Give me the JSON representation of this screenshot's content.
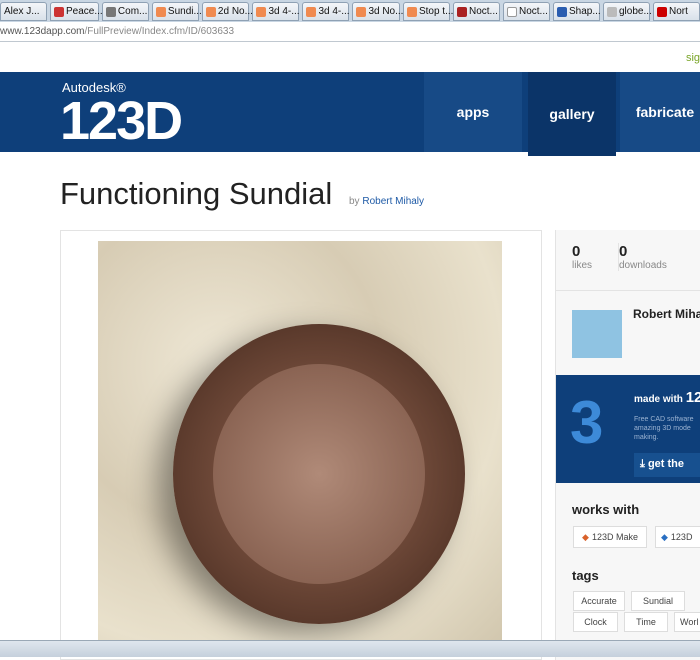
{
  "browser": {
    "tabs": [
      "Alex J...",
      "Peace...",
      "Com...",
      "Sundi...",
      "2d No...",
      "3d 4-...",
      "3d 4-...",
      "3d No...",
      "Stop t...",
      "Noct...",
      "Noct...",
      "Shap...",
      "globe...",
      "Nort"
    ],
    "url_domain": "www.123dapp.com",
    "url_path": "/FullPreview/Index.cfm/ID/603633"
  },
  "header": {
    "signin": "sig",
    "logo_small": "Autodesk®",
    "logo_big": "123D",
    "nav": [
      "apps",
      "gallery",
      "fabricate"
    ]
  },
  "page": {
    "title": "Functioning Sundial",
    "by_label": "by",
    "author": "Robert Mihaly"
  },
  "sidebar": {
    "stats": [
      {
        "value": "0",
        "label": "likes"
      },
      {
        "value": "0",
        "label": "downloads"
      }
    ],
    "author_name": "Robert Mihaly",
    "promo": {
      "title": "made with",
      "title_big": "12",
      "desc": "Free CAD software amazing 3D mode making.",
      "button": "get the"
    },
    "works_with_heading": "works with",
    "works_with": [
      "123D Make",
      "123D"
    ],
    "tags_heading": "tags",
    "tags": [
      "Accurate",
      "Sundial",
      "Clock",
      "Time",
      "Worl"
    ]
  }
}
